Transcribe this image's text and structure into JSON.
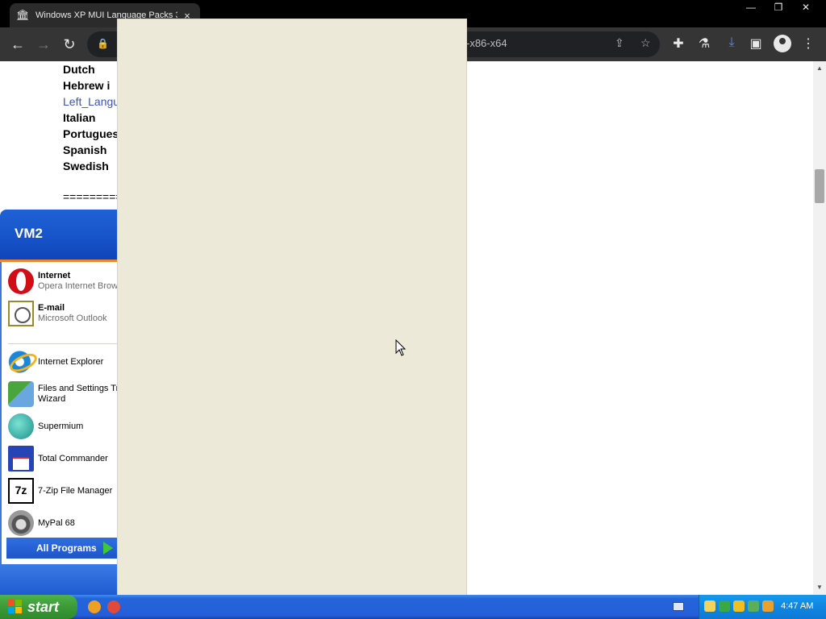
{
  "browser": {
    "tab": {
      "title": "Windows XP MUI Language Packs 3",
      "favicon": "bank-icon",
      "close_glyph": "×"
    },
    "window_controls": {
      "minimize": "—",
      "restore": "❐",
      "close": "✕"
    },
    "nav": {
      "back": "←",
      "forward": "→",
      "reload": "↻"
    },
    "omnibox": {
      "lock": "🔒",
      "url_visible": "-x86-x64"
    },
    "toolbar_icons": [
      "share-icon",
      "star-icon",
      "extensions-icon",
      "lab-flask-icon",
      "download-icon",
      "side-panel-icon",
      "profile-icon",
      "menu-icon"
    ]
  },
  "page": {
    "lines": [
      {
        "text": "Dutch",
        "style": "bold"
      },
      {
        "text": "Hebrew  i",
        "style": "bold"
      },
      {
        "text": "Left_Langu",
        "style": "link"
      },
      {
        "text": "Italian",
        "style": "bold"
      },
      {
        "text": "Portugues",
        "style": "bold"
      },
      {
        "text": "Spanish",
        "style": "bold"
      },
      {
        "text": "Swedish",
        "style": "bold"
      }
    ],
    "separator": "=========="
  },
  "start_menu": {
    "user": "VM2",
    "pinned": [
      {
        "title": "Internet",
        "subtitle": "Opera Internet Brow",
        "icon": "opera-icon"
      },
      {
        "title": "E-mail",
        "subtitle": "Microsoft Outlook",
        "icon": "outlook-icon"
      }
    ],
    "recent": [
      {
        "label": "Internet Explorer",
        "icon": "internet-explorer-icon"
      },
      {
        "label": "Files and Settings Tra",
        "label2": "Wizard",
        "icon": "files-settings-transfer-icon"
      },
      {
        "label": "Supermium",
        "icon": "supermium-icon"
      },
      {
        "label": "Total Commander",
        "icon": "total-commander-icon"
      },
      {
        "label": "7-Zip File Manager",
        "icon": "seven-zip-icon",
        "glyph": "7z"
      },
      {
        "label": "MyPal 68",
        "icon": "mypal-icon"
      }
    ],
    "all_programs": "All Programs"
  },
  "taskbar": {
    "start_label": "start",
    "clock": "4:47 AM",
    "colors": {
      "taskbar": "#245edb",
      "start": "#3c9a37",
      "tray": "#0f86e1"
    }
  }
}
